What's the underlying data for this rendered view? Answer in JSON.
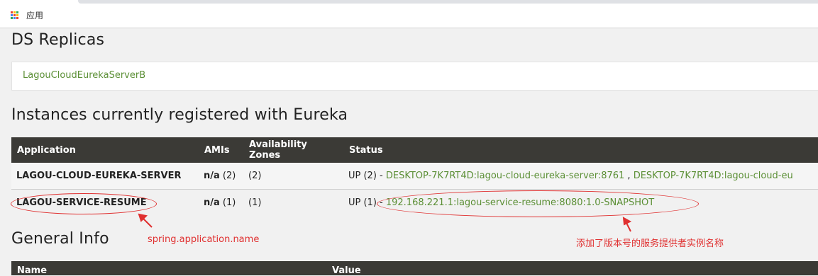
{
  "browser": {
    "apps_label": "应用",
    "apps_grid_colors": [
      "#ea4335",
      "#fbbc05",
      "#34a853",
      "#4285f4",
      "#ea4335",
      "#fbbc05",
      "#34a853",
      "#4285f4",
      "#ea4335"
    ]
  },
  "replicas": {
    "title": "DS Replicas",
    "items": [
      "LagouCloudEurekaServerB"
    ]
  },
  "instances": {
    "title": "Instances currently registered with Eureka",
    "headers": [
      "Application",
      "AMIs",
      "Availability Zones",
      "Status"
    ],
    "rows": [
      {
        "application": "LAGOU-CLOUD-EUREKA-SERVER",
        "amis_value": "n/a",
        "amis_count": "(2)",
        "zones": "(2)",
        "status_prefix": "UP (2) - ",
        "links": [
          "DESKTOP-7K7RT4D:lagou-cloud-eureka-server:8761",
          "DESKTOP-7K7RT4D:lagou-cloud-eu"
        ],
        "separator": " , "
      },
      {
        "application": "LAGOU-SERVICE-RESUME",
        "amis_value": "n/a",
        "amis_count": "(1)",
        "zones": "(1)",
        "status_prefix": "UP (1) - ",
        "links": [
          "192.168.221.1:lagou-service-resume:8080:1.0-SNAPSHOT"
        ]
      }
    ]
  },
  "general": {
    "title": "General Info",
    "headers": [
      "Name",
      "Value"
    ]
  },
  "annotations": {
    "app_name_note": "spring.application.name",
    "instance_note": "添加了版本号的服务提供者实例名称",
    "color": "#e03030"
  }
}
